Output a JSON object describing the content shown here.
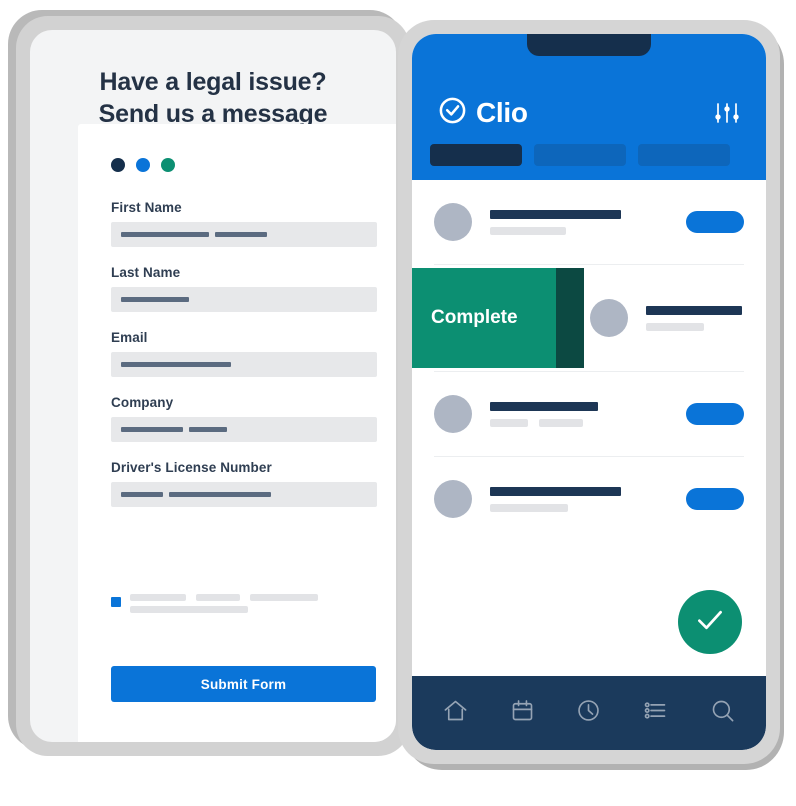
{
  "colors": {
    "brand_blue": "#0A74D8",
    "dark_navy": "#152F4C",
    "green": "#0C8F72",
    "green_dark": "#0C4942",
    "nav_navy": "#1B3A5C",
    "label_text": "#2F3E52",
    "heading_text": "#243245",
    "field_bg": "#E7E8EA",
    "fill_bar": "#5B6B80",
    "ghost_bar": "#E2E3E6",
    "avatar_grey": "#AEB6C4",
    "bezel_grey": "#D2D2D2"
  },
  "tablet": {
    "heading_line1": "Have a legal issue?",
    "heading_line2": "Send us a message",
    "status_dots": [
      {
        "name": "dot-navy",
        "color": "#152F4C"
      },
      {
        "name": "dot-blue",
        "color": "#0A74D8"
      },
      {
        "name": "dot-green",
        "color": "#0C8F72"
      }
    ],
    "form": {
      "fields": [
        {
          "label": "First Name",
          "fills": [
            88,
            52
          ]
        },
        {
          "label": "Last Name",
          "fills": [
            68
          ]
        },
        {
          "label": "Email",
          "fills": [
            110
          ]
        },
        {
          "label": "Company",
          "fills": [
            62,
            38
          ]
        },
        {
          "label": "Driver's License Number",
          "fills": [
            42,
            102
          ]
        }
      ],
      "consent": {
        "checkbox_checked": true,
        "line1_widths": [
          56,
          44,
          68
        ],
        "line2_widths": [
          118
        ]
      },
      "submit_label": "Submit Form"
    }
  },
  "phone": {
    "brand_name": "Clio",
    "brand_icon": "check-circle-icon",
    "filter_icon": "sliders-icon",
    "tabs": [
      {
        "name": "tab-primary",
        "active": true
      },
      {
        "name": "tab-secondary",
        "active": false
      },
      {
        "name": "tab-tertiary",
        "active": false
      }
    ],
    "rows": [
      {
        "name": "list-item-1",
        "title_width": 131,
        "sub_widths": [
          76
        ],
        "has_pill": true
      },
      {
        "name": "list-item-3",
        "title_width": 108,
        "sub_widths": [
          38,
          44
        ],
        "has_pill": true
      },
      {
        "name": "list-item-4",
        "title_width": 131,
        "sub_widths": [
          78
        ],
        "has_pill": true
      }
    ],
    "swiped_row": {
      "action_label": "Complete",
      "title_width": 96,
      "sub_widths": [
        58
      ]
    },
    "fab_icon": "checkmark-icon",
    "bottom_nav": [
      {
        "name": "nav-home",
        "icon": "home-icon"
      },
      {
        "name": "nav-calendar",
        "icon": "calendar-icon"
      },
      {
        "name": "nav-time",
        "icon": "clock-icon"
      },
      {
        "name": "nav-tasks",
        "icon": "list-icon"
      },
      {
        "name": "nav-search",
        "icon": "search-icon"
      }
    ]
  }
}
